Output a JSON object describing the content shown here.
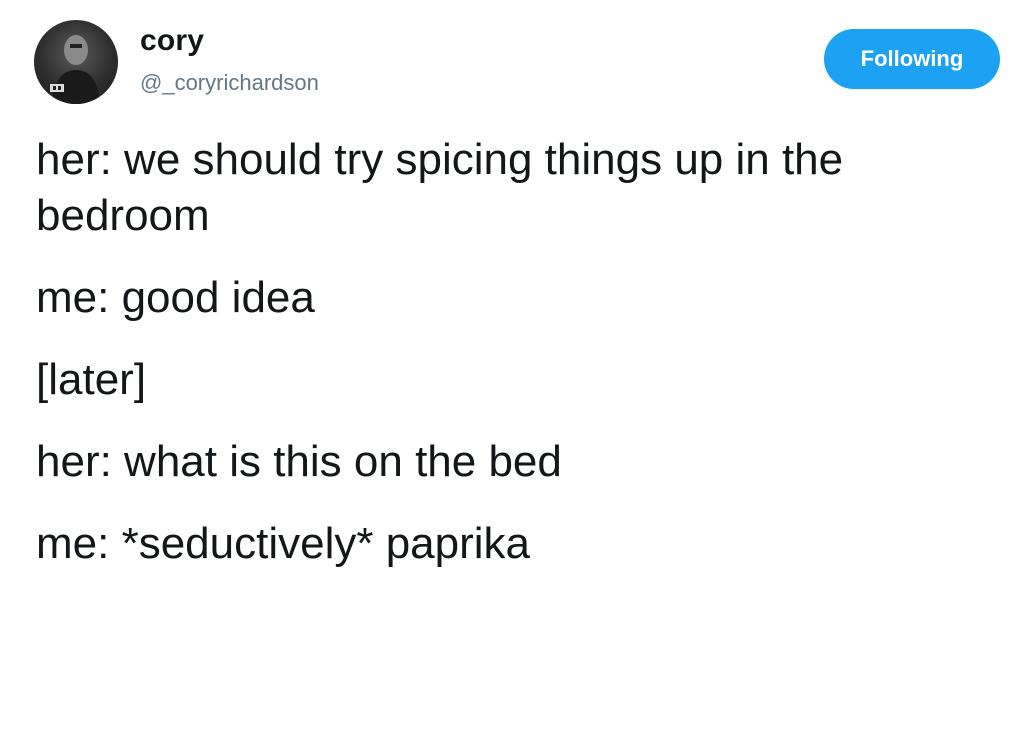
{
  "tweet": {
    "author": {
      "name": "cory",
      "handle": "@_coryrichardson"
    },
    "follow_button": {
      "label": "Following",
      "color": "#1da1f2"
    },
    "lines": [
      "her: we should try spicing things up in the bedroom",
      "me: good idea",
      "[later]",
      "her: what is this on the bed",
      "me: *seductively* paprika"
    ]
  }
}
